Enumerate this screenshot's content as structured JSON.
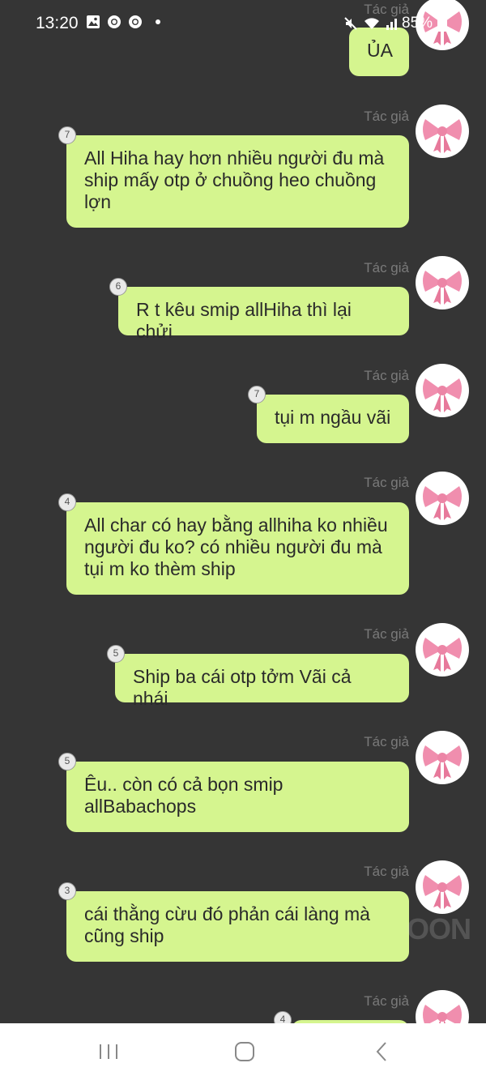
{
  "status_bar": {
    "time": "13:20",
    "battery": "85%",
    "icons": [
      "image-icon",
      "chrome-icon",
      "chrome-icon",
      "dot-icon",
      "mute-icon",
      "wifi-icon",
      "signal-icon",
      "battery-icon"
    ]
  },
  "colors": {
    "background": "#353535",
    "bubble": "#d5f58f",
    "author": "#7a7a7a"
  },
  "messages": [
    {
      "author": "Tác giả",
      "text": "ỦA",
      "badge": ""
    },
    {
      "author": "Tác giả",
      "text": "All Hiha hay hơn nhiều người đu mà ship mấy otp ở chuồng heo chuồng lợn",
      "badge": "7"
    },
    {
      "author": "Tác giả",
      "text": "R t kêu smip allHiha thì lại chửi",
      "badge": "6"
    },
    {
      "author": "Tác giả",
      "text": "tụi m ngầu vãi",
      "badge": "7"
    },
    {
      "author": "Tác giả",
      "text": "All char có hay bằng allhiha ko nhiều người đu ko? có nhiều người đu mà tụi m ko thèm ship",
      "badge": "4"
    },
    {
      "author": "Tác giả",
      "text": "Ship ba cái otp tởm Vãi cả nhái",
      "badge": "5"
    },
    {
      "author": "Tác giả",
      "text": "Êu.. còn có cả bọn smip allBabachops",
      "badge": "5"
    },
    {
      "author": "Tác giả",
      "text": "cái thằng cừu đó phản cái làng mà cũng ship",
      "badge": "3"
    },
    {
      "author": "Tác giả",
      "text": "",
      "badge": "4"
    }
  ],
  "watermark": "OON",
  "nav_bar": {
    "icons": [
      "recent-apps-icon",
      "home-icon",
      "back-icon"
    ]
  }
}
